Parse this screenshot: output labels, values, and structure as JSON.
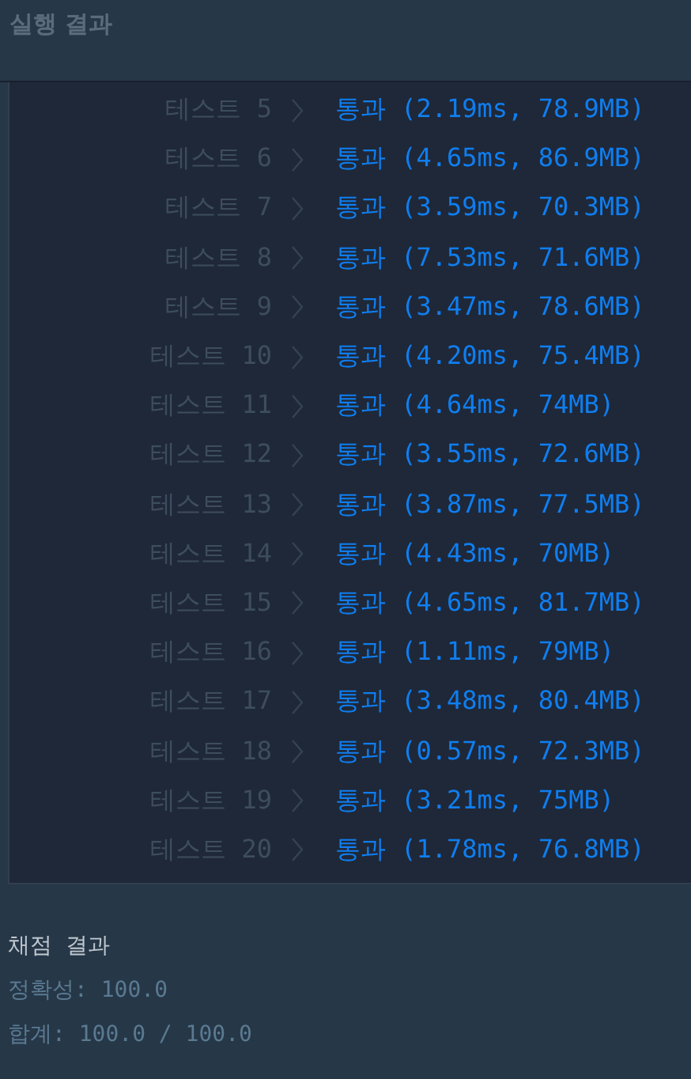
{
  "header": {
    "title": "실행 결과"
  },
  "tests": [
    {
      "label": "테스트 5",
      "result": "통과 (2.19ms, 78.9MB)"
    },
    {
      "label": "테스트 6",
      "result": "통과 (4.65ms, 86.9MB)"
    },
    {
      "label": "테스트 7",
      "result": "통과 (3.59ms, 70.3MB)"
    },
    {
      "label": "테스트 8",
      "result": "통과 (7.53ms, 71.6MB)"
    },
    {
      "label": "테스트 9",
      "result": "통과 (3.47ms, 78.6MB)"
    },
    {
      "label": "테스트 10",
      "result": "통과 (4.20ms, 75.4MB)"
    },
    {
      "label": "테스트 11",
      "result": "통과 (4.64ms, 74MB)"
    },
    {
      "label": "테스트 12",
      "result": "통과 (3.55ms, 72.6MB)"
    },
    {
      "label": "테스트 13",
      "result": "통과 (3.87ms, 77.5MB)"
    },
    {
      "label": "테스트 14",
      "result": "통과 (4.43ms, 70MB)"
    },
    {
      "label": "테스트 15",
      "result": "통과 (4.65ms, 81.7MB)"
    },
    {
      "label": "테스트 16",
      "result": "통과 (1.11ms, 79MB)"
    },
    {
      "label": "테스트 17",
      "result": "통과 (3.48ms, 80.4MB)"
    },
    {
      "label": "테스트 18",
      "result": "통과 (0.57ms, 72.3MB)"
    },
    {
      "label": "테스트 19",
      "result": "통과 (3.21ms, 75MB)"
    },
    {
      "label": "테스트 20",
      "result": "통과 (1.78ms, 76.8MB)"
    }
  ],
  "grading": {
    "title": "채점 결과",
    "lines": [
      "정확성: 100.0",
      "합계: 100.0 / 100.0"
    ]
  }
}
